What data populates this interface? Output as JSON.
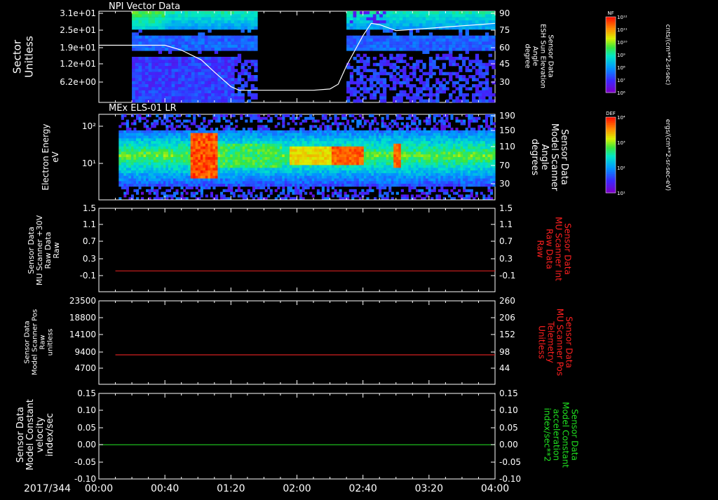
{
  "chart_data": [
    {
      "type": "heatmap",
      "title": "NPI Vector Data",
      "ylabel": "Sector\nUnitless",
      "y_ticks": [
        "3.1e+01",
        "2.5e+01",
        "1.9e+01",
        "1.2e+01",
        "6.2e+00"
      ],
      "right_axis": {
        "label": "Sensor Data\nESH Sun Elevation\nAngle\ndegree",
        "ticks": [
          "90",
          "75",
          "60",
          "45",
          "30"
        ],
        "range": [
          15,
          90
        ]
      },
      "series": [
        {
          "type": "line",
          "x_minutes": [
            0,
            20,
            30,
            40,
            50,
            62,
            70,
            80,
            85,
            90,
            100,
            110,
            120,
            130,
            140,
            145,
            150,
            160,
            165,
            170,
            180,
            190,
            200,
            210,
            220,
            230,
            240
          ],
          "y_degrees": [
            62,
            62,
            62,
            62,
            58,
            50,
            40,
            28,
            25,
            25,
            25,
            25,
            25,
            25,
            26,
            30,
            45,
            70,
            80,
            79,
            74,
            75,
            76,
            77,
            78,
            79,
            80
          ]
        }
      ],
      "colorbar": {
        "label": "NF",
        "units": "cnts/(cm**2-sr-sec)",
        "ticks": [
          "10¹²",
          "10¹¹",
          "10¹⁰",
          "10⁹",
          "10⁸",
          "10⁷",
          "10⁶"
        ]
      }
    },
    {
      "type": "heatmap",
      "title": "MEx ELS-01 LR",
      "ylabel": "Electron Energy\neV",
      "y_ticks": [
        "10²",
        "10¹"
      ],
      "right_axis": {
        "label": "Sensor Data\nModel Scanner\nAngle\ndegrees",
        "ticks": [
          "190",
          "150",
          "110",
          "70",
          "30"
        ],
        "range": [
          10,
          190
        ]
      },
      "series": [
        {
          "type": "line",
          "x_minutes": [
            0,
            240
          ],
          "y_degrees": [
            10,
            10
          ]
        }
      ],
      "colorbar": {
        "label": "DEF",
        "units": "ergs/(cm**2-sr-sec-eV)",
        "ticks": [
          "10⁴",
          "10³",
          "10²",
          "10¹"
        ]
      }
    },
    {
      "type": "line",
      "ylabel": "Sensor Data\nMU Scanner +30V\nRaw Data\nRaw",
      "y_ticks": [
        "1.5",
        "1.1",
        "0.7",
        "0.3",
        "-0.1"
      ],
      "ylim": [
        -0.5,
        1.5
      ],
      "right_axis": {
        "label": "Sensor Data\nMU Scanner Int\nRaw Data\nRaw",
        "ticks": [
          "1.5",
          "1.1",
          "0.7",
          "0.3",
          "-0.1"
        ],
        "color": "#ff2020"
      },
      "series": [
        {
          "color": "#d42020",
          "x_minutes": [
            10,
            240
          ],
          "values": [
            0,
            0
          ]
        }
      ]
    },
    {
      "type": "line",
      "ylabel": "Sensor Data\nModel Scanner Pos\nRaw\nunitless",
      "y_ticks": [
        "23500",
        "18800",
        "14100",
        "9400",
        "4700"
      ],
      "ylim": [
        0,
        23500
      ],
      "right_axis": {
        "label": "Sensor Data\nMU Scanner Pos\nTelemetry\nUnitless",
        "ticks": [
          "260",
          "206",
          "152",
          "98",
          "44"
        ],
        "color": "#ff2020"
      },
      "series": [
        {
          "color": "#d42020",
          "x_minutes": [
            10,
            240
          ],
          "values": [
            8300,
            8300
          ]
        }
      ]
    },
    {
      "type": "line",
      "ylabel": "Sensor Data\nModel Constant\nvelocity\nindex/sec",
      "y_ticks": [
        "0.15",
        "0.10",
        "0.05",
        "0.00",
        "-0.05",
        "-0.10"
      ],
      "ylim": [
        -0.1,
        0.15
      ],
      "right_axis": {
        "label": "Sensor Data\nModel Constant\nacceleration\nindex/sec**2",
        "ticks": [
          "0.15",
          "0.10",
          "0.05",
          "0.00",
          "-0.05",
          "-0.10"
        ],
        "color": "#20e020"
      },
      "series": [
        {
          "color": "#20d020",
          "x_minutes": [
            0,
            240
          ],
          "values": [
            0,
            0
          ]
        }
      ]
    }
  ],
  "x_axis": {
    "date_label": "2017/344",
    "tick_labels": [
      "00:00",
      "00:40",
      "01:20",
      "02:00",
      "02:40",
      "03:20",
      "04:00"
    ],
    "range_minutes": [
      0,
      240
    ]
  }
}
